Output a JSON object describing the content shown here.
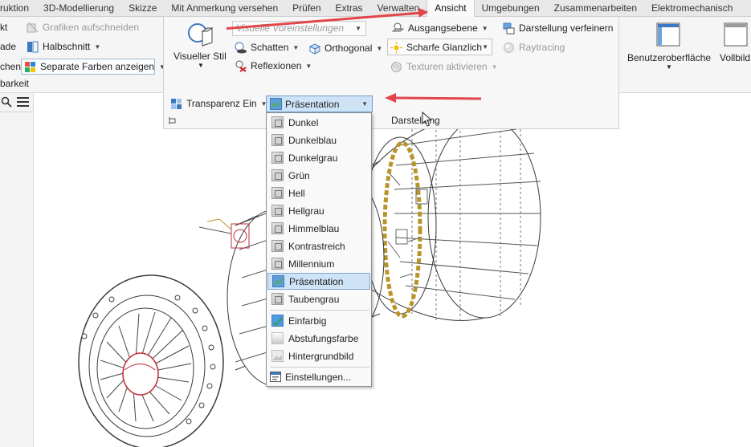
{
  "tabs": [
    {
      "label": "ruktion"
    },
    {
      "label": "3D-Modellierung"
    },
    {
      "label": "Skizze"
    },
    {
      "label": "Mit Anmerkung versehen"
    },
    {
      "label": "Prüfen"
    },
    {
      "label": "Extras"
    },
    {
      "label": "Verwalten"
    },
    {
      "label": "Ansicht"
    },
    {
      "label": "Umgebungen"
    },
    {
      "label": "Zusammenarbeiten"
    },
    {
      "label": "Elektromechanisch"
    }
  ],
  "ribbon": {
    "left": {
      "kt": "kt",
      "grafiken": "Grafiken aufschneiden",
      "ade": "ade",
      "halbschnitt": "Halbschnitt",
      "chen": "chen",
      "separate_farben": "Separate Farben anzeigen",
      "group_label": "barkeit"
    },
    "visual": {
      "visueller_stil": "Visueller Stil",
      "voreinstellungen_placeholder": "Visuelle Voreinstellungen",
      "schatten": "Schatten",
      "orthogonal": "Orthogonal",
      "reflexionen": "Reflexionen",
      "ausgangsebene": "Ausgangsebene",
      "scharfe_glanzlicht": "Scharfe Glanzlich",
      "texturen": "Texturen aktivieren",
      "darstellung_verfeinern": "Darstellung verfeinern",
      "raytracing": "Raytracing",
      "transparenz": "Transparenz Ein",
      "group_label": "Darstellung"
    },
    "right": {
      "benutzeroberflaeche": "Benutzeroberfläche",
      "vollbild": "Vollbild"
    }
  },
  "appearance_combo": {
    "value": "Präsentation"
  },
  "dropdown": {
    "items": [
      {
        "label": "Dunkel"
      },
      {
        "label": "Dunkelblau"
      },
      {
        "label": "Dunkelgrau"
      },
      {
        "label": "Grün"
      },
      {
        "label": "Hell"
      },
      {
        "label": "Hellgrau"
      },
      {
        "label": "Himmelblau"
      },
      {
        "label": "Kontrastreich"
      },
      {
        "label": "Millennium"
      },
      {
        "label": "Präsentation",
        "selected": true
      },
      {
        "label": "Taubengrau"
      }
    ],
    "background_items": [
      {
        "label": "Einfarbig"
      },
      {
        "label": "Abstufungsfarbe"
      },
      {
        "label": "Hintergrundbild"
      }
    ],
    "settings": "Einstellungen..."
  },
  "colors": {
    "accent_blue": "#cfe3f7",
    "arrow_red": "#e0454b",
    "engine_line": "#3a3a3a",
    "ring_gold": "#b8942a",
    "nose_red": "#c0303a"
  }
}
